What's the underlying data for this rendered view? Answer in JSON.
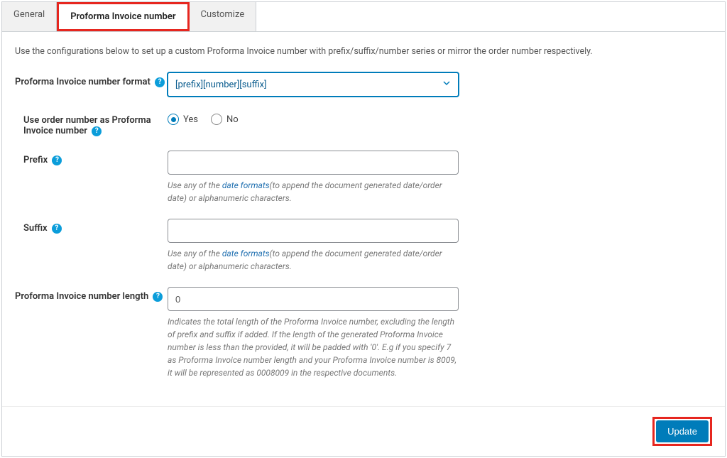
{
  "tabs": {
    "general": "General",
    "proforma": "Proforma Invoice number",
    "customize": "Customize"
  },
  "description": "Use the configurations below to set up a custom Proforma Invoice number with prefix/suffix/number series or mirror the order number respectively.",
  "fields": {
    "format": {
      "label": "Proforma Invoice number format",
      "value": "[prefix][number][suffix]"
    },
    "use_order": {
      "label": "Use order number as Proforma Invoice number",
      "yes": "Yes",
      "no": "No"
    },
    "prefix": {
      "label": "Prefix",
      "helper_pre": "Use any of the ",
      "link": "date formats",
      "helper_post": "(to append the document generated date/order date) or alphanumeric characters."
    },
    "suffix": {
      "label": "Suffix",
      "helper_pre": "Use any of the ",
      "link": "date formats",
      "helper_post": "(to append the document generated date/order date) or alphanumeric characters."
    },
    "length": {
      "label": "Proforma Invoice number length",
      "value": "0",
      "helper": "Indicates the total length of the Proforma Invoice number, excluding the length of prefix and suffix if added. If the length of the generated Proforma Invoice number is less than the provided, it will be padded with '0'. E.g if you specify 7 as Proforma Invoice number length and your Proforma Invoice number is 8009, it will be represented as 0008009 in the respective documents."
    }
  },
  "footer": {
    "update": "Update"
  }
}
